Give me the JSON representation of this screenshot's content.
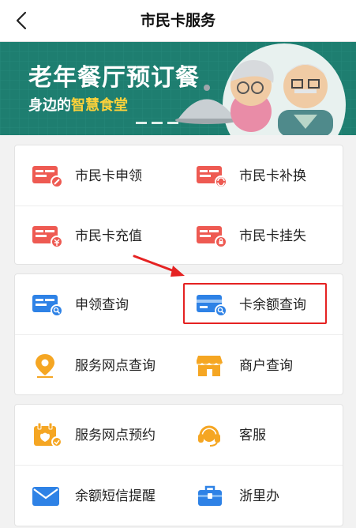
{
  "header": {
    "title": "市民卡服务"
  },
  "banner": {
    "title": "老年餐厅预订餐",
    "subtitle_prefix": "身边的",
    "subtitle_highlight": "智慧食堂"
  },
  "groups": [
    {
      "items": [
        {
          "label": "市民卡申领",
          "icon": "card-apply-icon"
        },
        {
          "label": "市民卡补换",
          "icon": "card-replace-icon"
        },
        {
          "label": "市民卡充值",
          "icon": "card-recharge-icon"
        },
        {
          "label": "市民卡挂失",
          "icon": "card-report-loss-icon"
        }
      ]
    },
    {
      "items": [
        {
          "label": "申领查询",
          "icon": "apply-query-icon"
        },
        {
          "label": "卡余额查询",
          "icon": "card-balance-icon"
        },
        {
          "label": "服务网点查询",
          "icon": "location-pin-icon"
        },
        {
          "label": "商户查询",
          "icon": "shop-icon"
        }
      ]
    },
    {
      "items": [
        {
          "label": "服务网点预约",
          "icon": "calendar-icon"
        },
        {
          "label": "客服",
          "icon": "headset-icon"
        },
        {
          "label": "余额短信提醒",
          "icon": "mail-icon"
        },
        {
          "label": "浙里办",
          "icon": "briefcase-icon"
        }
      ]
    }
  ],
  "colors": {
    "red_icon": "#ee5a52",
    "blue_icon": "#2e82e6",
    "orange_icon": "#f5a623",
    "banner_bg": "#1e7e70",
    "annotation_red": "#e52222"
  }
}
